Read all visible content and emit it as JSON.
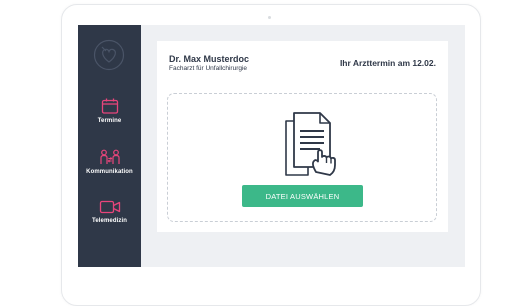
{
  "colors": {
    "sidebar": "#2f3848",
    "accent": "#e8457b",
    "button": "#3cb889",
    "screen_bg": "#eef0f3"
  },
  "sidebar": {
    "logo_icon": "heart-stethoscope-logo-icon",
    "items": [
      {
        "label": "Termine",
        "icon": "calendar-icon"
      },
      {
        "label": "Kommunikation",
        "icon": "people-icon"
      },
      {
        "label": "Telemedizin",
        "icon": "video-camera-icon"
      }
    ]
  },
  "header": {
    "doctor_name": "Dr. Max Musterdoc",
    "doctor_title": "Facharzt für Unfallchirurgie",
    "appointment": "Ihr Arzttermin am 12.02."
  },
  "upload": {
    "icon": "document-hand-icon",
    "button_label": "DATEI AUSWÄHLEN"
  }
}
